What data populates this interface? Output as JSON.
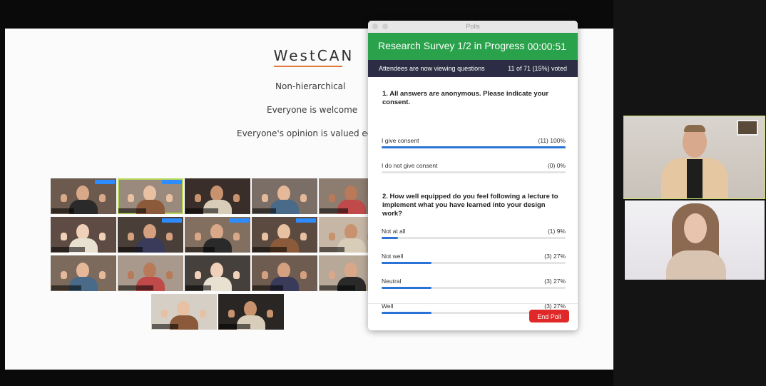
{
  "slide": {
    "title": "WestCAN",
    "lines": [
      "Non-hierarchical",
      "Everyone is welcome",
      "Everyone's opinion is valued equ"
    ]
  },
  "poll": {
    "window_title": "Polls",
    "header_title": "Research Survey 1/2 in Progress",
    "timer": "00:00:51",
    "status_text": "Attendees are now viewing questions",
    "voted_text": "11 of 71 (15%) voted",
    "questions": [
      {
        "text": "1. All answers are anonymous. Please indicate your consent.",
        "options": [
          {
            "label": "I give consent",
            "value": "(11) 100%",
            "percent": 100
          },
          {
            "label": "I do not give consent",
            "value": "(0) 0%",
            "percent": 0
          }
        ]
      },
      {
        "text": "2. How well equipped do you feel following a lecture to implement what you have learned into your design work?",
        "options": [
          {
            "label": "Not at all",
            "value": "(1) 9%",
            "percent": 9
          },
          {
            "label": "Not well",
            "value": "(3) 27%",
            "percent": 27
          },
          {
            "label": "Neutral",
            "value": "(3) 27%",
            "percent": 27
          },
          {
            "label": "Well",
            "value": "(3) 27%",
            "percent": 27
          }
        ]
      }
    ],
    "end_button": "End Poll"
  },
  "colors": {
    "poll_header": "#2aa24b",
    "poll_status_bar": "#2c2c44",
    "bar_fill": "#2b72d6",
    "end_button": "#e02828",
    "active_speaker": "#c8e26a"
  }
}
